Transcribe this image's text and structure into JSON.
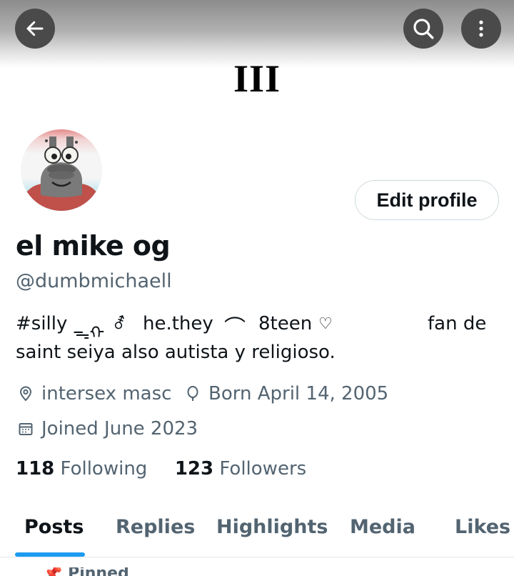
{
  "header": {
    "back_icon": "arrow-left-icon",
    "search_icon": "search-icon",
    "more_icon": "more-vertical-icon",
    "banner_text": "III"
  },
  "profile": {
    "avatar": "avatar-cartoon",
    "edit_profile_label": "Edit profile",
    "display_name": "el mike og",
    "handle": "@dumbmichaell",
    "bio": {
      "hashtag": "#silly",
      "symbol1": "ᯓᡣ",
      "symbol2": "⚦",
      "pronouns": "he.they",
      "symbol3": "⌒",
      "age": "8teen",
      "symbol4": "♡",
      "fan_de": "fan de",
      "line2": "saint seiya also autista y religioso."
    },
    "location": "intersex masc",
    "birthday": "Born April 14, 2005",
    "joined": "Joined June 2023",
    "following_count": "118",
    "following_label": "Following",
    "followers_count": "123",
    "followers_label": "Followers"
  },
  "tabs": [
    {
      "label": "Posts",
      "active": true
    },
    {
      "label": "Replies",
      "active": false
    },
    {
      "label": "Highlights",
      "active": false
    },
    {
      "label": "Media",
      "active": false
    },
    {
      "label": "Likes",
      "active": false
    }
  ],
  "pinned": {
    "label": "Pinned"
  },
  "colors": {
    "accent": "#1d9bf0",
    "text_primary": "#0f1419",
    "text_secondary": "#536471"
  }
}
